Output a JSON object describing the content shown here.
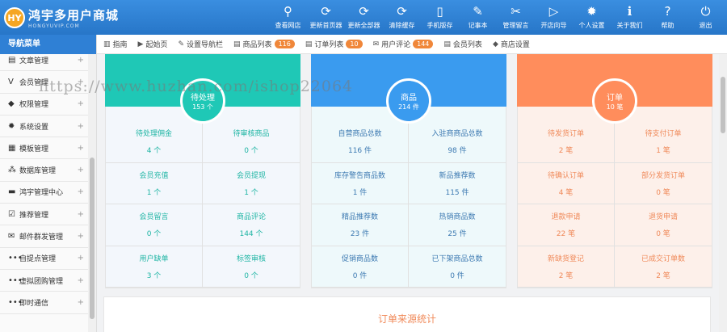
{
  "header": {
    "logo_badge": "HY",
    "logo_title": "鸿宇多用户商城",
    "logo_sub": "HONGYUVIP.COM",
    "nav": [
      {
        "icon": "search-icon",
        "glyph": "⚲",
        "label": "查看网店"
      },
      {
        "icon": "refresh-icon",
        "glyph": "⟳",
        "label": "更新首页器"
      },
      {
        "icon": "refresh-all-icon",
        "glyph": "⟳",
        "label": "更新全部器"
      },
      {
        "icon": "clear-cache-icon",
        "glyph": "⟳",
        "label": "清除缓存"
      },
      {
        "icon": "mobile-icon",
        "glyph": "▯",
        "label": "手机版存"
      },
      {
        "icon": "notepad-icon",
        "glyph": "✎",
        "label": "记事本"
      },
      {
        "icon": "wrench-icon",
        "glyph": "✂",
        "label": "管理留言"
      },
      {
        "icon": "play-icon",
        "glyph": "▷",
        "label": "开店向导"
      },
      {
        "icon": "gear-icon",
        "glyph": "✹",
        "label": "个人设置"
      },
      {
        "icon": "info-icon",
        "glyph": "ℹ",
        "label": "关于我们"
      },
      {
        "icon": "help-icon",
        "glyph": "?",
        "label": "帮助"
      },
      {
        "icon": "power-icon",
        "glyph": "⏻",
        "label": "退出"
      }
    ]
  },
  "sidebar": {
    "title": "导航菜单",
    "items": [
      {
        "icon": "doc-icon",
        "glyph": "▤",
        "label": "文章管理"
      },
      {
        "icon": "vip-icon",
        "glyph": "V",
        "label": "会员管理"
      },
      {
        "icon": "shield-icon",
        "glyph": "◆",
        "label": "权限管理"
      },
      {
        "icon": "settings-icon",
        "glyph": "✹",
        "label": "系统设置"
      },
      {
        "icon": "template-icon",
        "glyph": "▦",
        "label": "模板管理"
      },
      {
        "icon": "database-icon",
        "glyph": "⁂",
        "label": "数据库管理"
      },
      {
        "icon": "truck-icon",
        "glyph": "▬",
        "label": "鸿宇管理中心"
      },
      {
        "icon": "checklist-icon",
        "glyph": "☑",
        "label": "推荐管理"
      },
      {
        "icon": "mail-icon",
        "glyph": "✉",
        "label": "邮件群发管理"
      },
      {
        "icon": "dots-icon",
        "glyph": "•••",
        "label": "自提点管理"
      },
      {
        "icon": "dots-icon",
        "glyph": "•••",
        "label": "虚拟团购管理"
      },
      {
        "icon": "dots-icon",
        "glyph": "•••",
        "label": "即时通信"
      }
    ]
  },
  "tabs": [
    {
      "icon": "barcode-icon",
      "glyph": "▥",
      "label": "指南",
      "badge": ""
    },
    {
      "icon": "play-circle-icon",
      "glyph": "▶",
      "label": "起始页",
      "badge": ""
    },
    {
      "icon": "edit-icon",
      "glyph": "✎",
      "label": "设置导航栏",
      "badge": ""
    },
    {
      "icon": "list-icon",
      "glyph": "▤",
      "label": "商品列表",
      "badge": "116"
    },
    {
      "icon": "order-icon",
      "glyph": "▤",
      "label": "订单列表",
      "badge": "10"
    },
    {
      "icon": "comment-icon",
      "glyph": "✉",
      "label": "用户评论",
      "badge": "144"
    },
    {
      "icon": "user-icon",
      "glyph": "▤",
      "label": "会员列表",
      "badge": ""
    },
    {
      "icon": "store-icon",
      "glyph": "◆",
      "label": "商店设置",
      "badge": ""
    }
  ],
  "cards": [
    {
      "title": "待处理",
      "count": "153 个",
      "cells": [
        {
          "label": "待处理佣金",
          "value": "4 个"
        },
        {
          "label": "待审核商品",
          "value": "0 个"
        },
        {
          "label": "会员充值",
          "value": "1 个"
        },
        {
          "label": "会员提现",
          "value": "1 个"
        },
        {
          "label": "会员留言",
          "value": "0 个"
        },
        {
          "label": "商品评论",
          "value": "144 个"
        },
        {
          "label": "用户缺单",
          "value": "3 个"
        },
        {
          "label": "标签审核",
          "value": "0 个"
        }
      ]
    },
    {
      "title": "商品",
      "count": "214 件",
      "cells": [
        {
          "label": "自营商品总数",
          "value": "116 件"
        },
        {
          "label": "入驻商商品总数",
          "value": "98 件"
        },
        {
          "label": "库存警告商品数",
          "value": "1 件"
        },
        {
          "label": "新品推荐数",
          "value": "115 件"
        },
        {
          "label": "精品推荐数",
          "value": "23 件"
        },
        {
          "label": "热销商品数",
          "value": "25 件"
        },
        {
          "label": "促销商品数",
          "value": "0 件"
        },
        {
          "label": "已下架商品总数",
          "value": "0 件"
        }
      ]
    },
    {
      "title": "订单",
      "count": "10 笔",
      "cells": [
        {
          "label": "待发货订单",
          "value": "2 笔"
        },
        {
          "label": "待支付订单",
          "value": "1 笔"
        },
        {
          "label": "待确认订单",
          "value": "4 笔"
        },
        {
          "label": "部分发货订单",
          "value": "0 笔"
        },
        {
          "label": "退款申请",
          "value": "22 笔"
        },
        {
          "label": "退货申请",
          "value": "0 笔"
        },
        {
          "label": "新缺货登记",
          "value": "2 笔"
        },
        {
          "label": "已成交订单数",
          "value": "2 笔"
        }
      ]
    }
  ],
  "stats": {
    "title": "订单来源统计"
  },
  "watermark": "https://www.huzhan.com/ishop22064",
  "colors": {
    "header": "#2f80d5",
    "green": "#1fc8b6",
    "blue": "#3a9bef",
    "orange": "#ff8d5c",
    "badge": "#f0873a"
  }
}
